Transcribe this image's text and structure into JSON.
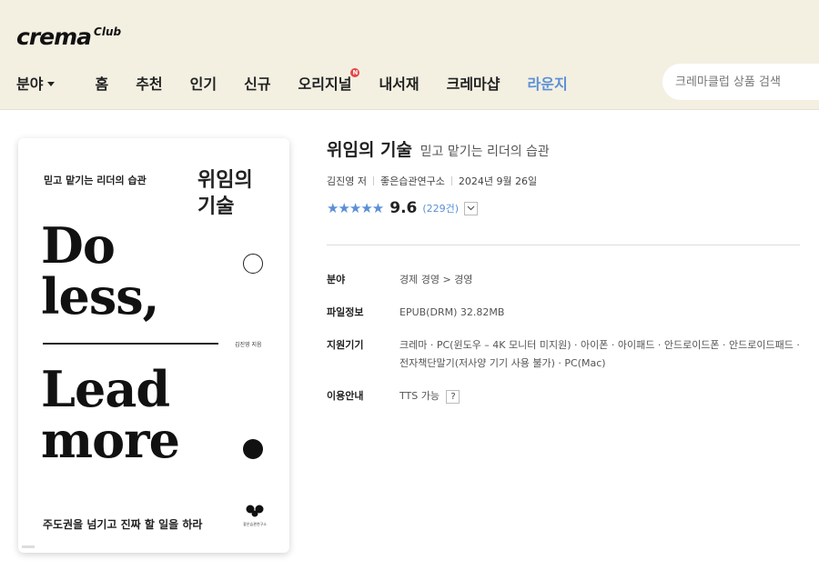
{
  "header": {
    "logo": "crema",
    "logo_sub": "Club",
    "nav": {
      "category": "분야",
      "items": [
        "홈",
        "추천",
        "인기",
        "신규",
        "오리지널",
        "내서재",
        "크레마샵",
        "라운지"
      ],
      "badge": "N",
      "active": "라운지"
    },
    "search_placeholder": "크레마클럽 상품 검색"
  },
  "cover": {
    "subtitle": "믿고 맡기는 리더의 습관",
    "title_line1": "위임의",
    "title_line2": "기술",
    "en_line1": "Do",
    "en_line2": "less,",
    "en_line3": "Lead",
    "en_line4": "more",
    "author": "김진영 지음",
    "tagline": "주도권을 넘기고 진짜 할 일을 하라",
    "publisher": "좋은습관연구소"
  },
  "book": {
    "title": "위임의 기술",
    "subtitle": "믿고 맡기는 리더의 습관",
    "author": "김진영 저",
    "publisher": "좋은습관연구소",
    "date": "2024년 9월 26일",
    "stars": "★★★★★",
    "rating": "9.6",
    "review_count": "(229건)"
  },
  "info": {
    "category_label": "분야",
    "category_value": "경제 경영 > 경영",
    "file_label": "파일정보",
    "file_value": "EPUB(DRM) 32.82MB",
    "device_label": "지원기기",
    "device_value": "크레마 · PC(윈도우 – 4K 모니터 미지원) · 아이폰 · 아이패드 · 안드로이드폰 · 안드로이드패드 · 전자책단말기(저사양 기기 사용 불가) · PC(Mac)",
    "usage_label": "이용안내",
    "usage_value": "TTS 가능",
    "help": "?"
  },
  "colors": {
    "header_bg": "#f3f0e2",
    "accent": "#5b8fd6",
    "badge": "#e84545"
  }
}
